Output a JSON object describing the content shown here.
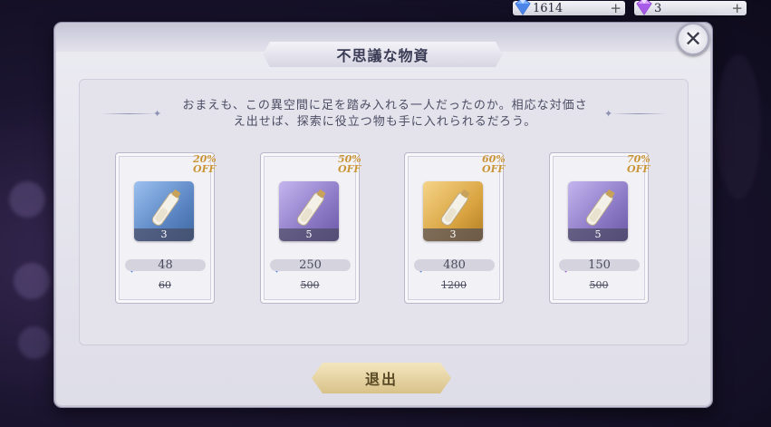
{
  "currencies": [
    {
      "icon": "blue-gem-icon",
      "value": "1614",
      "plus": "+"
    },
    {
      "icon": "purple-gem-icon",
      "value": "3",
      "plus": "+"
    }
  ],
  "dialog": {
    "title": "不思議な物資",
    "close_label": "✕",
    "description_line1": "おまえも、この異空間に足を踏み入れる一人だったのか。相応な対価さ",
    "description_line2": "え出せば、探索に役立つ物も手に入れられるだろう。",
    "exit_label": "退出"
  },
  "offers": [
    {
      "discount": "20%\nOFF",
      "item_color": "blue",
      "quantity": "3",
      "currency_icon": "blue-gem-icon",
      "price": "48",
      "original_price": "60"
    },
    {
      "discount": "50%\nOFF",
      "item_color": "purple",
      "quantity": "5",
      "currency_icon": "blue-gem-icon",
      "price": "250",
      "original_price": "500"
    },
    {
      "discount": "60%\nOFF",
      "item_color": "gold",
      "quantity": "3",
      "currency_icon": "blue-gem-icon",
      "price": "480",
      "original_price": "1200"
    },
    {
      "discount": "70%\nOFF",
      "item_color": "purple",
      "quantity": "5",
      "currency_icon": "purple-gem-icon",
      "price": "150",
      "original_price": "500"
    }
  ],
  "colors": {
    "blue_item": "#5b86c4",
    "purple_item": "#8c79c6",
    "gold_item": "#d9a441",
    "discount": "#c99437"
  }
}
